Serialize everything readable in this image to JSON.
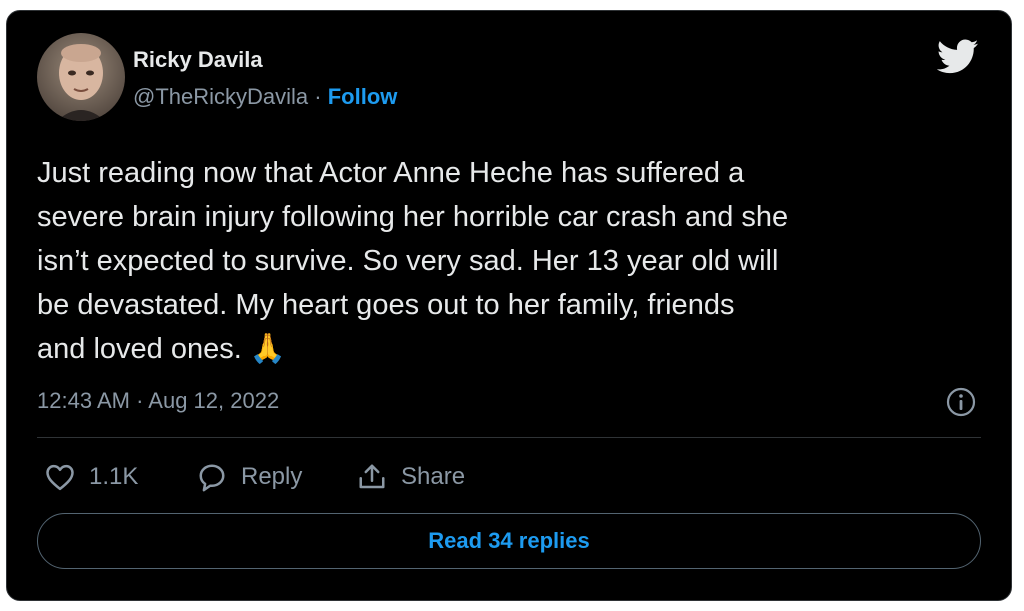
{
  "author": {
    "name": "Ricky Davila",
    "handle": "@TheRickyDavila",
    "separator": " · ",
    "follow_label": "Follow",
    "avatar_icon": "avatar-photo"
  },
  "tweet": {
    "text": "Just reading now that Actor Anne Heche has suffered a\nsevere brain injury following her horrible car crash and she\nisn’t expected to survive. So very sad. Her 13 year old will\nbe devastated. My heart goes out to her family, friends\nand loved ones. 🙏",
    "timestamp": "12:43 AM · Aug 12, 2022"
  },
  "actions": {
    "like_count": "1.1K",
    "reply_label": "Reply",
    "share_label": "Share"
  },
  "read_replies_label": "Read 34 replies",
  "icons": {
    "brand": "twitter-bird-icon",
    "info": "info-icon",
    "like": "heart-icon",
    "reply": "speech-bubble-icon",
    "share": "share-upload-icon"
  },
  "colors": {
    "background": "#000000",
    "text": "#e7e9ea",
    "secondary": "#8b98a5",
    "accent": "#1d9bf0",
    "border": "#2f3336"
  }
}
